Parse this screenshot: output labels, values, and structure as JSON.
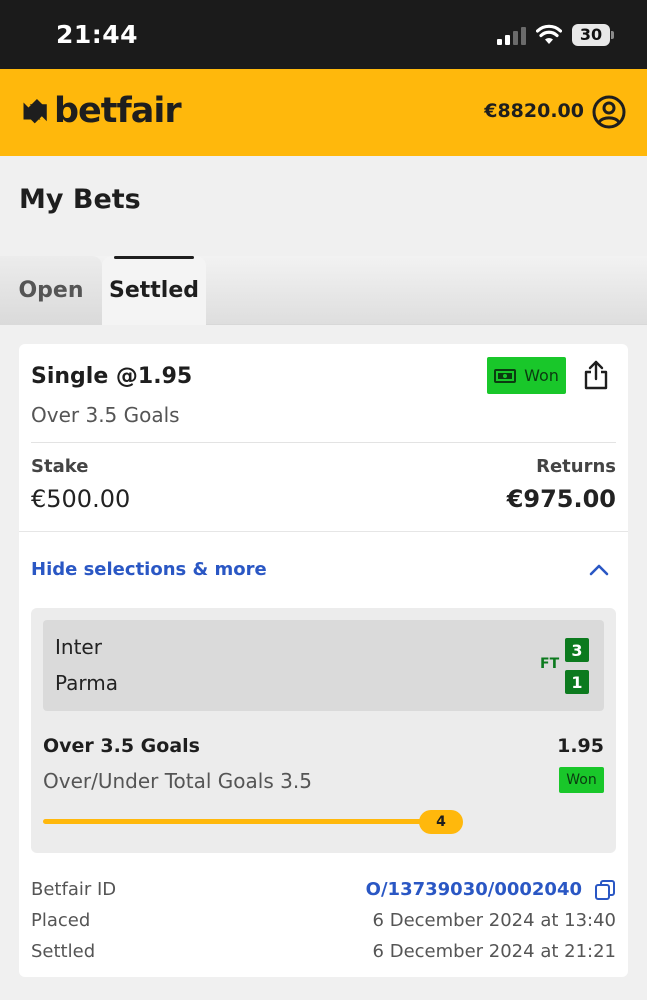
{
  "status_bar": {
    "time": "21:44",
    "battery": "30"
  },
  "header": {
    "logo_text": "betfair",
    "balance": "€8820.00"
  },
  "page": {
    "title": "My Bets"
  },
  "tabs": [
    {
      "label": "Open",
      "active": false
    },
    {
      "label": "Settled",
      "active": true
    }
  ],
  "bet": {
    "title": "Single @1.95",
    "status": "Won",
    "market": "Over 3.5 Goals",
    "stake_label": "Stake",
    "stake": "€500.00",
    "returns_label": "Returns",
    "returns": "€975.00",
    "toggle_label": "Hide selections & more",
    "selection": {
      "home_team": "Inter",
      "away_team": "Parma",
      "period": "FT",
      "home_score": "3",
      "away_score": "1",
      "name": "Over 3.5 Goals",
      "odds": "1.95",
      "market": "Over/Under Total Goals 3.5",
      "status": "Won",
      "progress_value": "4"
    },
    "meta": {
      "id_label": "Betfair ID",
      "id_value": "O/13739030/0002040",
      "placed_label": "Placed",
      "placed_value": "6 December 2024 at 13:40",
      "settled_label": "Settled",
      "settled_value": "6 December 2024 at 21:21"
    }
  },
  "colors": {
    "brand": "#ffb80c",
    "won": "#19c72a",
    "score": "#0c7a1e",
    "link": "#2a57c4"
  }
}
